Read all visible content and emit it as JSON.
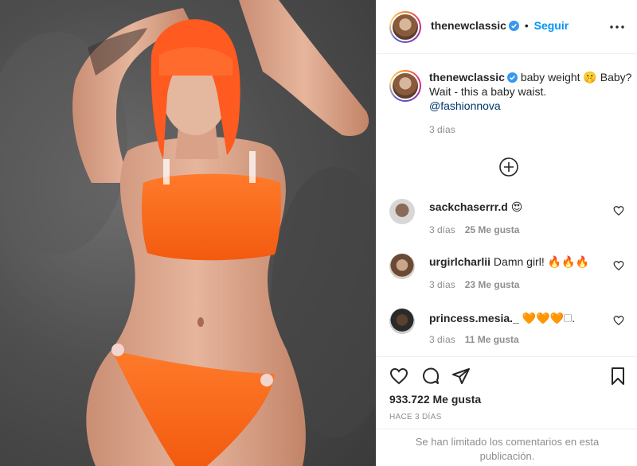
{
  "post": {
    "header": {
      "username": "thenewclassic",
      "separator": "•",
      "follow_label": "Seguir",
      "icons": {
        "verified": "verified-badge-icon",
        "more": "more-options-icon"
      }
    },
    "caption": {
      "username": "thenewclassic",
      "text": "baby weight 🤫 Baby? Wait - this a baby waist.",
      "mention": "@fashionnova",
      "time": "3 días"
    },
    "load_more_icon": "plus-circle-icon",
    "comments": [
      {
        "username": "sackchaserrr.d",
        "text": "😍",
        "time": "3 días",
        "likes": "25 Me gusta"
      },
      {
        "username": "urgirlcharlii",
        "text": "Damn girl! 🔥🔥🔥",
        "time": "3 días",
        "likes": "23 Me gusta"
      },
      {
        "username": "princess.mesia._",
        "text": "🧡🧡🧡🗆.",
        "time": "3 días",
        "likes": "11 Me gusta"
      }
    ],
    "actions": {
      "icons": [
        "heart-icon",
        "comment-icon",
        "share-icon",
        "bookmark-icon"
      ],
      "likes": "933.722 Me gusta",
      "posted": "HACE 3 DÍAS",
      "comments_limited": "Se han limitado los comentarios en esta publicación."
    },
    "colors": {
      "accent": "#0095f6",
      "verified": "#3897f0",
      "text": "#262626",
      "muted": "#8e8e8e",
      "swimsuit": "#ff6a1a",
      "hair": "#ff5a1f"
    }
  }
}
